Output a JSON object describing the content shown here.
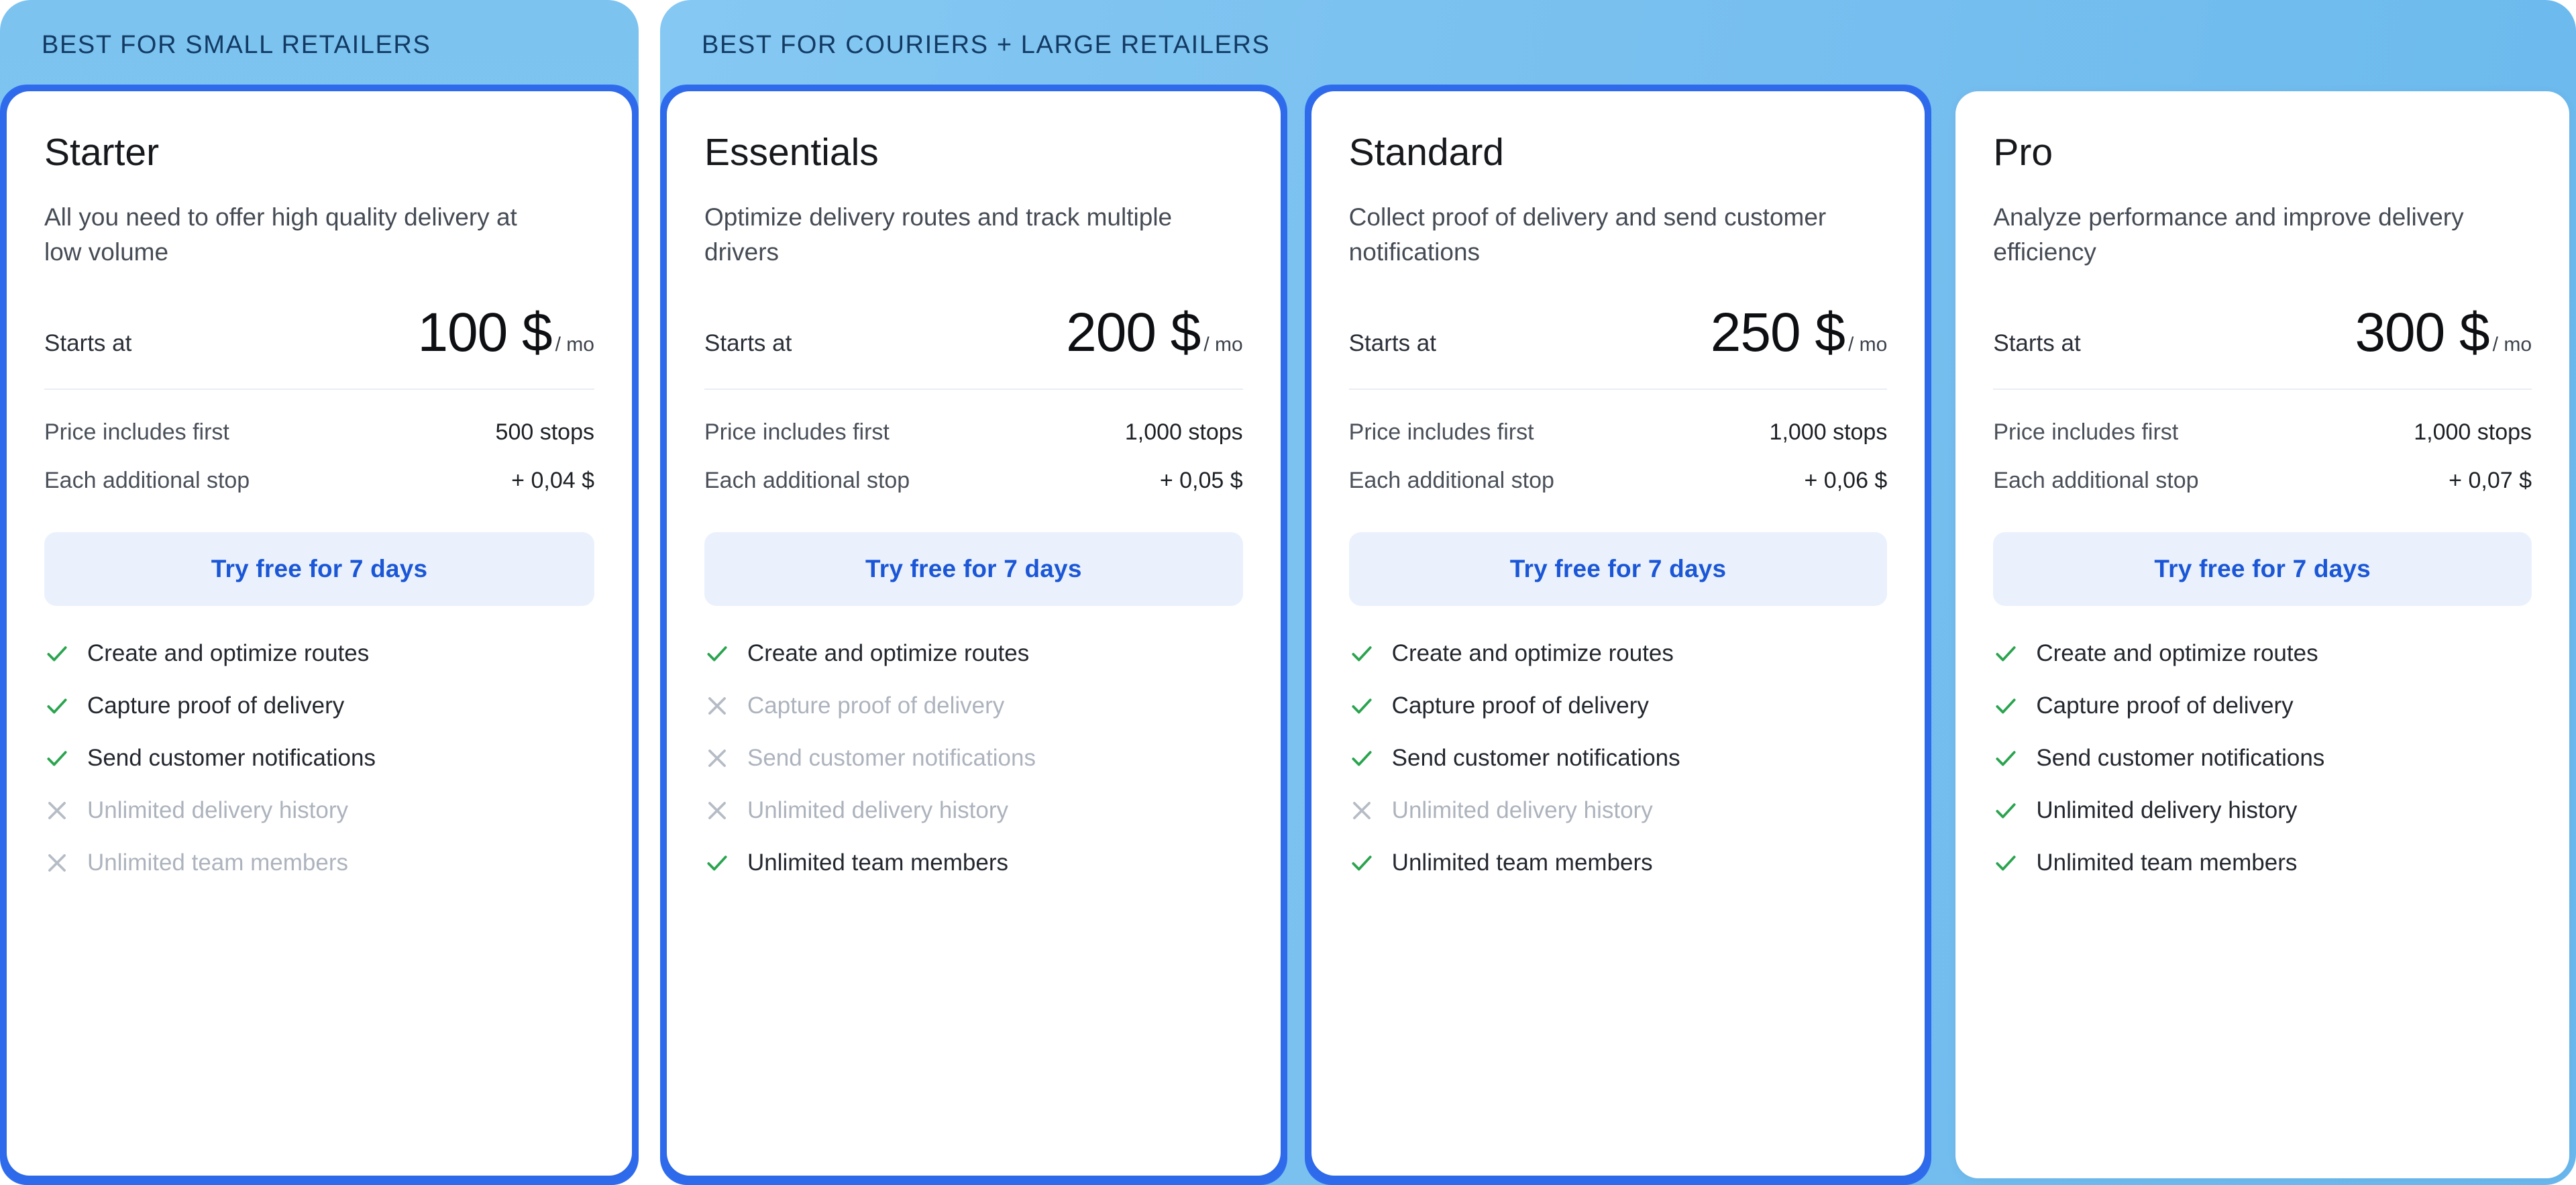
{
  "groups": [
    {
      "banner_label": "BEST FOR SMALL RETAILERS"
    },
    {
      "banner_label": "BEST FOR COURIERS + LARGE RETAILERS"
    }
  ],
  "labels": {
    "starts_at": "Starts at",
    "price_includes_first": "Price includes first",
    "each_additional_stop": "Each additional stop",
    "period": "/ mo",
    "cta": "Try free for 7 days"
  },
  "colors": {
    "cta_text": "#1a56d6",
    "cta_background": "#eaf1fd",
    "highlight_border": "#2f6ced",
    "banner_blue": "#7cc3f0",
    "check_green": "#2aa44f",
    "cross_gray": "#b6bcc6"
  },
  "plans": [
    {
      "name": "Starter",
      "description": "All you need to offer high quality delivery at low volume",
      "price": "100 $",
      "period": "/ mo",
      "included_stops": "500 stops",
      "additional_stop_price": "+ 0,04 $",
      "cta": "Try free for 7 days",
      "features": [
        {
          "label": "Create and optimize routes",
          "included": true
        },
        {
          "label": "Capture proof of delivery",
          "included": true
        },
        {
          "label": "Send customer notifications",
          "included": true
        },
        {
          "label": "Unlimited delivery history",
          "included": false
        },
        {
          "label": "Unlimited team members",
          "included": false
        }
      ]
    },
    {
      "name": "Essentials",
      "description": "Optimize delivery routes and track multiple drivers",
      "price": "200 $",
      "period": "/ mo",
      "included_stops": "1,000 stops",
      "additional_stop_price": "+ 0,05 $",
      "cta": "Try free for 7 days",
      "features": [
        {
          "label": "Create and optimize routes",
          "included": true
        },
        {
          "label": "Capture proof of delivery",
          "included": false
        },
        {
          "label": "Send customer notifications",
          "included": false
        },
        {
          "label": "Unlimited delivery history",
          "included": false
        },
        {
          "label": "Unlimited team members",
          "included": true
        }
      ]
    },
    {
      "name": "Standard",
      "description": "Collect proof of delivery and send customer notifications",
      "price": "250 $",
      "period": "/ mo",
      "included_stops": "1,000 stops",
      "additional_stop_price": "+ 0,06 $",
      "cta": "Try free for 7 days",
      "features": [
        {
          "label": "Create and optimize routes",
          "included": true
        },
        {
          "label": "Capture proof of delivery",
          "included": true
        },
        {
          "label": "Send customer notifications",
          "included": true
        },
        {
          "label": "Unlimited delivery history",
          "included": false
        },
        {
          "label": "Unlimited team members",
          "included": true
        }
      ]
    },
    {
      "name": "Pro",
      "description": "Analyze performance and improve delivery efficiency",
      "price": "300 $",
      "period": "/ mo",
      "included_stops": "1,000 stops",
      "additional_stop_price": "+ 0,07 $",
      "cta": "Try free for 7 days",
      "features": [
        {
          "label": "Create and optimize routes",
          "included": true
        },
        {
          "label": "Capture proof of delivery",
          "included": true
        },
        {
          "label": "Send customer notifications",
          "included": true
        },
        {
          "label": "Unlimited delivery history",
          "included": true
        },
        {
          "label": "Unlimited team members",
          "included": true
        }
      ]
    }
  ]
}
